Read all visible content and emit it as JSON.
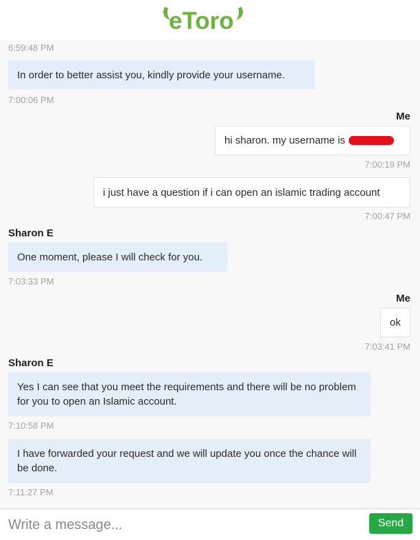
{
  "header": {
    "logo_text": "eToro",
    "logo_color": "#6cb33e"
  },
  "messages": [
    {
      "type": "time",
      "side": "left",
      "text": "6:59:48 PM"
    },
    {
      "type": "bubble",
      "from": "agent",
      "text": "In order to better assist you, kindly provide your username."
    },
    {
      "type": "time",
      "side": "left",
      "text": "7:00:06 PM"
    },
    {
      "type": "sender",
      "side": "right",
      "text": "Me"
    },
    {
      "type": "bubble",
      "from": "me",
      "text": "hi sharon. my username is",
      "redacted": true
    },
    {
      "type": "time",
      "side": "right",
      "text": "7:00:19 PM"
    },
    {
      "type": "bubble",
      "from": "me",
      "text": "i just have a question if i can open an islamic trading account"
    },
    {
      "type": "time",
      "side": "right",
      "text": "7:00:47 PM"
    },
    {
      "type": "sender",
      "side": "left",
      "text": "Sharon E"
    },
    {
      "type": "bubble",
      "from": "agent",
      "text": "One moment, please I will check for you."
    },
    {
      "type": "time",
      "side": "left",
      "text": "7:03:33 PM"
    },
    {
      "type": "sender",
      "side": "right",
      "text": "Me"
    },
    {
      "type": "bubble",
      "from": "me",
      "text": "ok"
    },
    {
      "type": "time",
      "side": "right",
      "text": "7:03:41 PM"
    },
    {
      "type": "sender",
      "side": "left",
      "text": "Sharon E"
    },
    {
      "type": "bubble",
      "from": "agent",
      "text": "Yes I can see that you meet the requirements and there will be no problem for you to open an Islamic account."
    },
    {
      "type": "time",
      "side": "left",
      "text": "7:10:58 PM"
    },
    {
      "type": "bubble",
      "from": "agent",
      "text": "I have forwarded your request and we will update you once the chance will be done."
    },
    {
      "type": "time",
      "side": "left",
      "text": "7:11:27 PM"
    }
  ],
  "composer": {
    "placeholder": "Write a message...",
    "send_label": "Send",
    "send_color": "#27a844"
  }
}
